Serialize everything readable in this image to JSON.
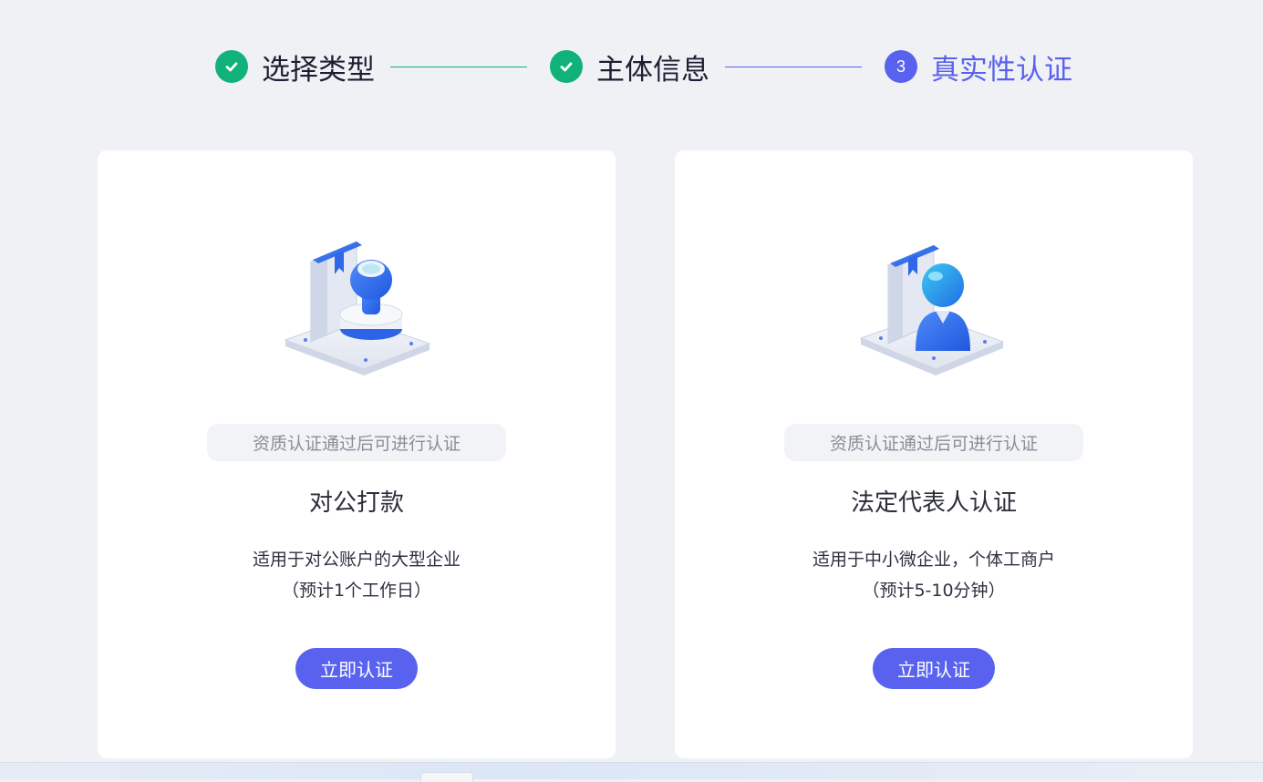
{
  "steps": [
    {
      "label": "选择类型",
      "status": "done"
    },
    {
      "label": "主体信息",
      "status": "done"
    },
    {
      "number": "3",
      "label": "真实性认证",
      "status": "active"
    }
  ],
  "cards": [
    {
      "icon": "company-seal-stamp-icon",
      "notice": "资质认证通过后可进行认证",
      "title": "对公打款",
      "desc_line1": "适用于对公账户的大型企业",
      "desc_line2": "（预计1个工作日）",
      "button": "立即认证"
    },
    {
      "icon": "legal-representative-person-icon",
      "notice": "资质认证通过后可进行认证",
      "title": "法定代表人认证",
      "desc_line1": "适用于中小微企业，个体工商户",
      "desc_line2": "（预计5-10分钟）",
      "button": "立即认证"
    }
  ],
  "colors": {
    "accent": "#5862ee",
    "success": "#10b27a",
    "background": "#f0f1f5",
    "card": "#ffffff"
  }
}
